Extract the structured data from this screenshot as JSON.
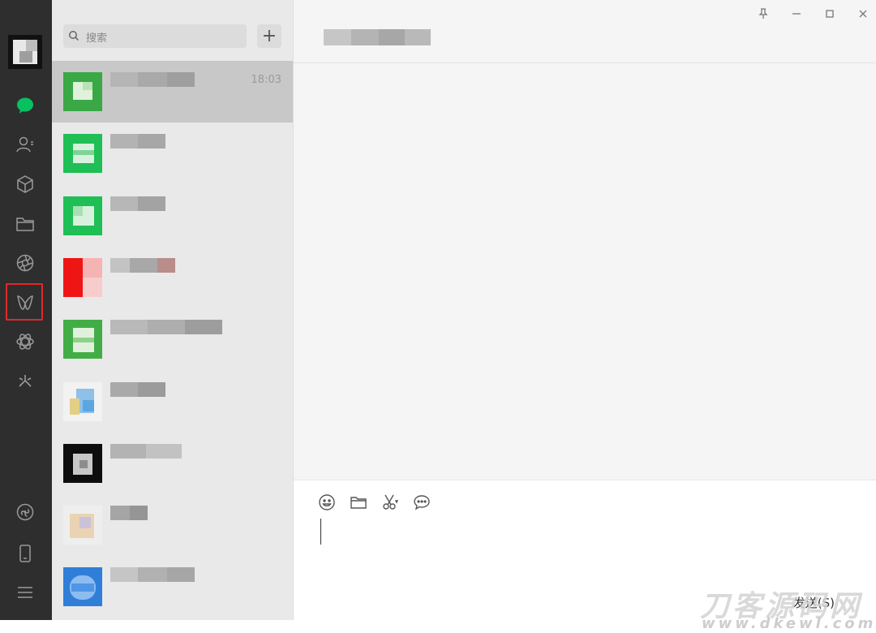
{
  "search": {
    "placeholder": "搜索"
  },
  "add_button": {
    "label": "+"
  },
  "chats": [
    {
      "time": "18:03"
    }
  ],
  "composer": {
    "send_label": "发送(S)"
  },
  "watermark": {
    "text": "刀客源码网",
    "url_text": "www.dkewl.com"
  },
  "window_buttons": {
    "pin": "⊥",
    "minimize": "—",
    "maximize": "□",
    "close": "✕"
  },
  "colors": {
    "nav_bg": "#2e2e2e",
    "list_bg": "#e9e9e9",
    "active_chat": "#c8c8c8",
    "accent_green": "#07c160",
    "highlight": "#e02a2a"
  },
  "nav_icons": [
    "chat-icon",
    "contacts-icon",
    "favorites-icon",
    "files-icon",
    "moments-icon",
    "channels-icon",
    "search-discover-icon",
    "mini-programs-icon",
    "miniprogram-link-icon",
    "phone-icon",
    "menu-icon"
  ]
}
